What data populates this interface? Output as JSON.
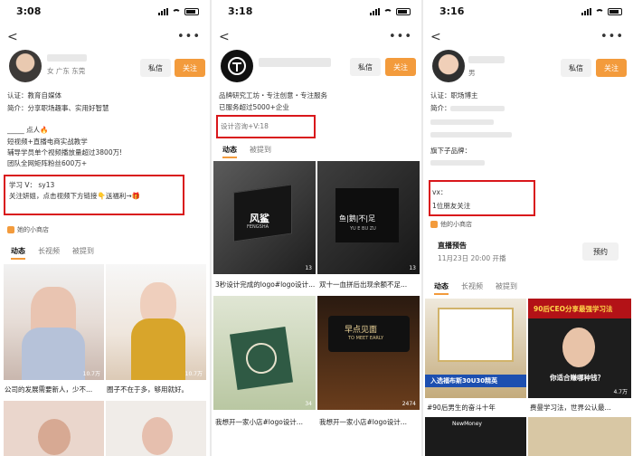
{
  "panels": [
    {
      "time": "3:08",
      "gender_location": "女 广东 东莞",
      "msg": "私信",
      "follow": "关注",
      "cert": "认证：教育自媒体",
      "intro": "简介：分享职场趣事、实用好智慧",
      "line_a": "_____ 点人🔥",
      "line_b": "短视频+直播电商实战教学",
      "line_c": "辅导学员单个视频播放量超过3800万!",
      "line_d": "团队全网矩阵粉丝600万+",
      "study": "学习 V：  sy13",
      "study2": "关注妍姐，点击视频下方链接👇送福利→🎁",
      "shop": "她的小商店",
      "tabs": [
        "动态",
        "长视频",
        "被提到"
      ],
      "tile_likes": [
        "10.7万",
        "10.7万"
      ],
      "captions": [
        "公司的发展需要新人，少不...",
        "圈子不在于多，够用就好。"
      ]
    },
    {
      "time": "3:18",
      "msg": "私信",
      "follow": "关注",
      "intro": "品牌研究工坊・专注创意・专注服务",
      "served": "已服务超过5000+企业",
      "design": "设计咨询+V:18",
      "tabs": [
        "动态",
        "被提到"
      ],
      "tile_likes": [
        "13",
        "13",
        "34",
        "2474"
      ],
      "logo1": "风鲨",
      "logo1_sub": "FENGSHA",
      "logo2": "鱼|鹅|不|足",
      "logo2_sub": "YU E BU ZU",
      "logo4": "早点见面",
      "logo4_sub": "TO MEET EARLY",
      "captions": [
        "3秒设计完成的logo#logo设计...",
        "双十一血拼后出现余额不足...",
        "我想开一家小店#logo设计...",
        "我想开一家小店#logo设计..."
      ]
    },
    {
      "time": "3:16",
      "gender": "男",
      "msg": "私信",
      "follow": "关注",
      "cert": "认证：职场博主",
      "intro": "简介：",
      "brand": "旗下子品牌：",
      "vx": "vx：",
      "friends": "1位朋友关注",
      "shop": "他的小商店",
      "live_title": "直播预告",
      "live_time": "11月23日 20:00 开播",
      "reserve": "预约",
      "tabs": [
        "动态",
        "长视频",
        "被提到"
      ],
      "banner": "90后CEO分享最强学习法",
      "tile1_text": "入选福布斯30U30精英",
      "tile2_text": "你适合赚哪种钱？",
      "tile2_likes": "4.7万",
      "captions": [
        "#90后男生的奋斗十年",
        "费曼学习法，世界公认最..."
      ],
      "footer": "NewMoney"
    }
  ],
  "colors": {
    "accent": "#f39b3c",
    "highlight": "#d9171b"
  }
}
